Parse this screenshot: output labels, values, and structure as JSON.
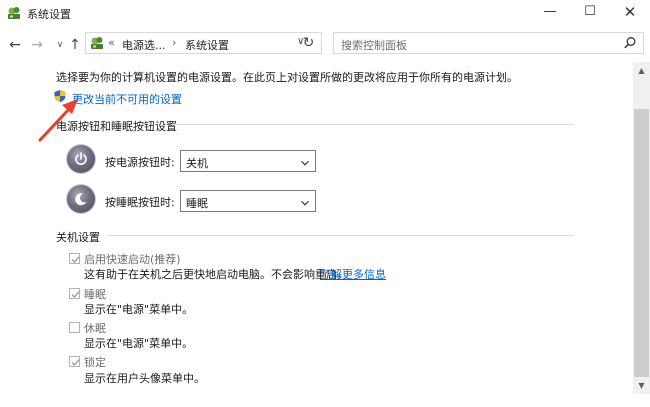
{
  "window": {
    "title": "系统设置",
    "minimize_glyph": "—",
    "maximize_glyph": "☐",
    "close_glyph": "✕"
  },
  "navigation": {
    "back_glyph": "←",
    "forward_glyph": "→",
    "recent_glyph": "∨",
    "up_glyph": "↑"
  },
  "address": {
    "separator": "«",
    "crumbs": [
      "电源选...",
      "系统设置"
    ],
    "crumb_arrow": "›",
    "dropdown_glyph": "∨",
    "refresh_glyph": "↻"
  },
  "search": {
    "placeholder": "搜索控制面板"
  },
  "content": {
    "intro": "选择要为你的计算机设置的电源设置。在此页上对设置所做的更改将应用于你所有的电源计划。",
    "change_link": "更改当前不可用的设置",
    "power_section": {
      "title": "电源按钮和睡眠按钮设置",
      "power_button_label": "按电源按钮时:",
      "power_button_value": "关机",
      "sleep_button_label": "按睡眠按钮时:",
      "sleep_button_value": "睡眠"
    },
    "shutdown_section": {
      "title": "关机设置",
      "items": [
        {
          "label": "启用快速启动(推荐)",
          "desc": "这有助于在关机之后更快地启动电脑。不会影响重启。",
          "link": "了解更多信息",
          "checked": true
        },
        {
          "label": "睡眠",
          "desc": "显示在\"电源\"菜单中。",
          "checked": true
        },
        {
          "label": "休眠",
          "desc": "显示在\"电源\"菜单中。",
          "checked": false
        },
        {
          "label": "锁定",
          "desc": "显示在用户头像菜单中。",
          "checked": true
        }
      ]
    }
  },
  "colors": {
    "link": "#0066cc",
    "annotation_arrow": "#e8402a"
  },
  "icons": {
    "app": "control-panel-icon",
    "shield": "uac-shield-icon",
    "power": "power-icon",
    "sleep": "moon-icon",
    "search": "search-icon"
  }
}
